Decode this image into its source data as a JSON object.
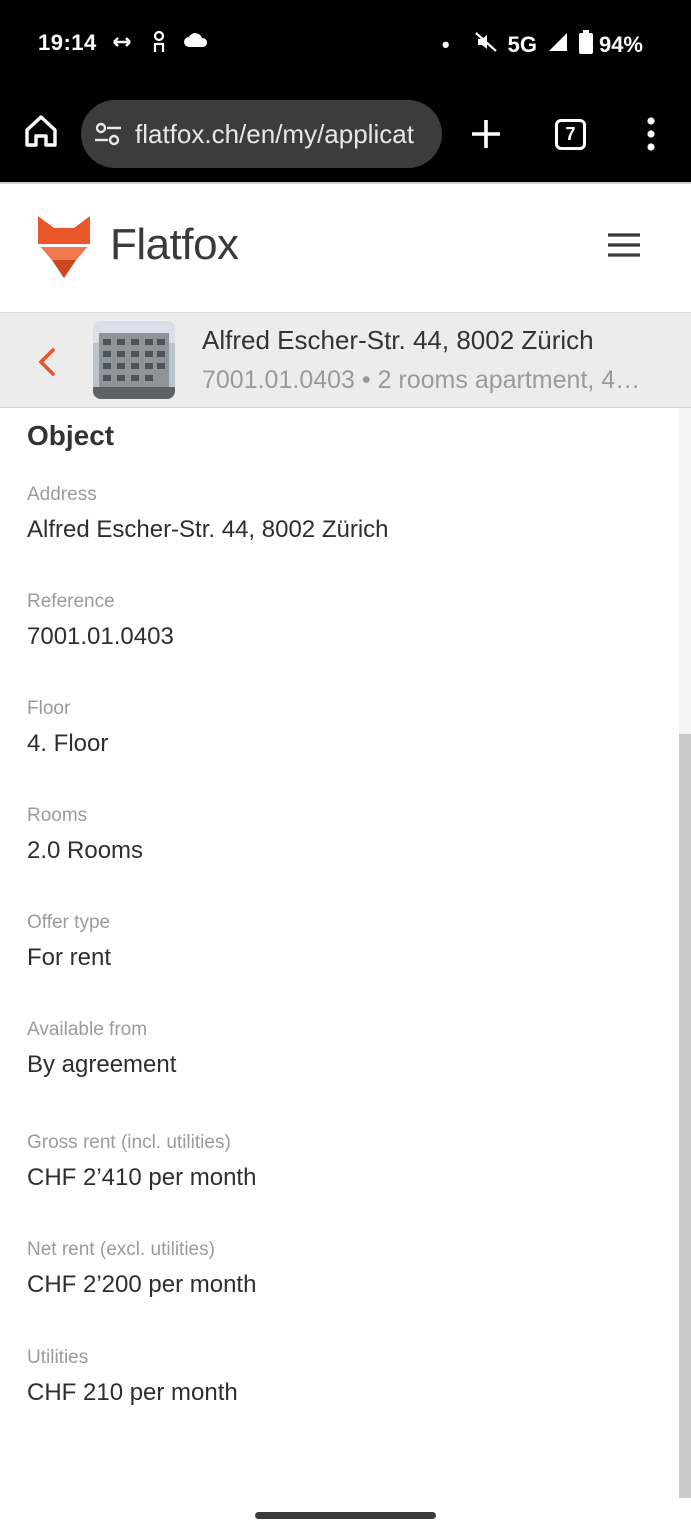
{
  "status_bar": {
    "time": "19:14",
    "network": "5G",
    "battery": "94%",
    "icons": [
      "cast-icon",
      "accessibility-icon",
      "cloud-icon",
      "dot-icon",
      "mute-icon",
      "signal-icon",
      "battery-icon"
    ]
  },
  "browser": {
    "url": "flatfox.ch/en/my/applicat",
    "tab_count": "7"
  },
  "site": {
    "logo_text": "Flatfox",
    "brand_color": "#e8562a"
  },
  "listing": {
    "title": "Alfred Escher-Str. 44, 8002 Zürich",
    "subtitle": "7001.01.0403 • 2 rooms apartment, 4…"
  },
  "object": {
    "section_title": "Object",
    "fields": [
      {
        "label": "Address",
        "value": "Alfred Escher-Str. 44, 8002 Zürich"
      },
      {
        "label": "Reference",
        "value": "7001.01.0403"
      },
      {
        "label": "Floor",
        "value": "4. Floor"
      },
      {
        "label": "Rooms",
        "value": "2.0 Rooms"
      },
      {
        "label": "Offer type",
        "value": "For rent"
      },
      {
        "label": "Available from",
        "value": "By agreement"
      },
      {
        "label": "Gross rent (incl. utilities)",
        "value": "CHF 2’410 per month"
      },
      {
        "label": "Net rent (excl. utilities)",
        "value": "CHF 2’200 per month"
      },
      {
        "label": "Utilities",
        "value": "CHF 210 per month"
      }
    ]
  }
}
